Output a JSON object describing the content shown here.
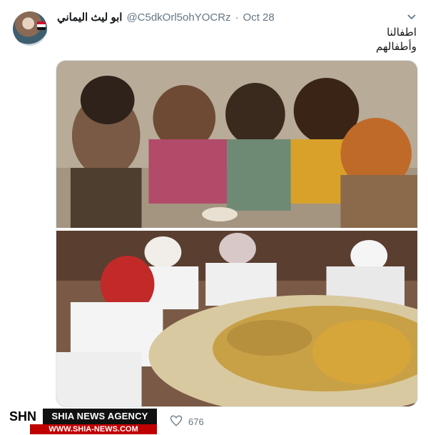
{
  "tweet": {
    "display_name": "ابو ليث اليماني",
    "handle": "@C5dkOrl5ohYOCRz",
    "separator": "·",
    "date": "Oct 28",
    "text_line1": "اطفالنا",
    "text_line2": "وأطفالهم"
  },
  "actions": {
    "like_count": "676"
  },
  "watermark": {
    "logo": "SHN",
    "agency": "SHIA NEWS AGENCY",
    "url": "WWW.SHIA-NEWS.COM"
  },
  "icons": {
    "caret": "chevron-down-icon",
    "like": "heart-icon"
  },
  "colors": {
    "text_primary": "#14171a",
    "text_secondary": "#657786",
    "watermark_red": "#c00000"
  }
}
